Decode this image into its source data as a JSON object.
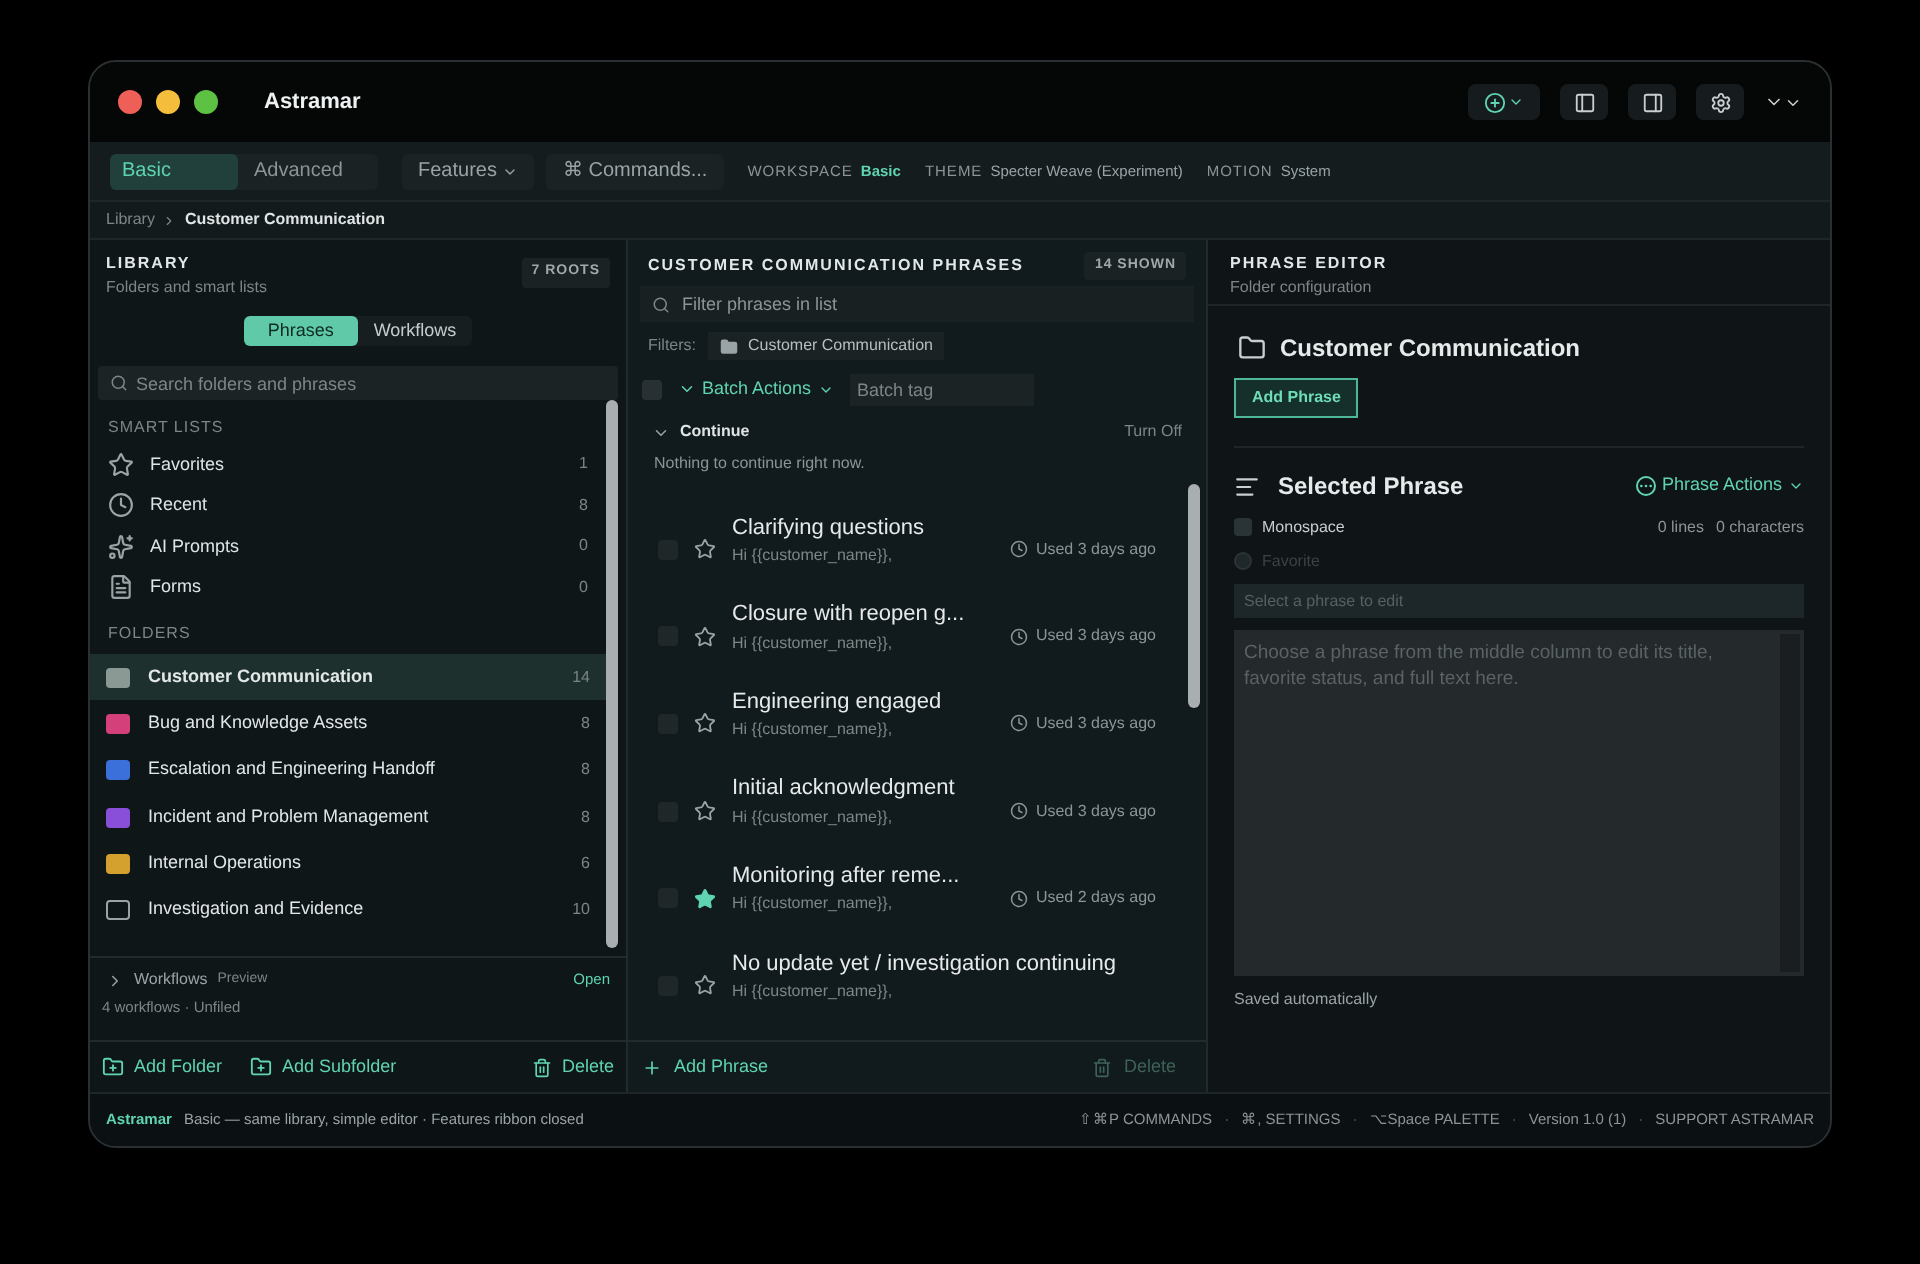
{
  "window": {
    "title": "Astramar"
  },
  "toolbar": {
    "modes": [
      {
        "label": "Basic",
        "selected": true
      },
      {
        "label": "Advanced",
        "selected": false
      }
    ],
    "features": "Features",
    "commands": "⌘ Commands...",
    "settings": [
      {
        "label": "WORKSPACE",
        "value": "Basic",
        "accent": true
      },
      {
        "label": "THEME",
        "value": "Specter Weave (Experiment)",
        "accent": false
      },
      {
        "label": "MOTION",
        "value": "System",
        "accent": false
      }
    ]
  },
  "breadcrumb": [
    "Library",
    "Customer Communication"
  ],
  "library": {
    "title": "LIBRARY",
    "subtitle": "Folders and smart lists",
    "badge": "7 ROOTS",
    "segments": [
      {
        "label": "Phrases",
        "selected": true
      },
      {
        "label": "Workflows",
        "selected": false
      }
    ],
    "search": {
      "placeholder": "Search folders and phrases"
    },
    "smart_lists_title": "SMART LISTS",
    "smart_lists": [
      {
        "kind": "star",
        "label": "Favorites",
        "count": "1"
      },
      {
        "kind": "clock",
        "label": "Recent",
        "count": "8"
      },
      {
        "kind": "sparkle",
        "label": "AI Prompts",
        "count": "0"
      },
      {
        "kind": "form",
        "label": "Forms",
        "count": "0"
      }
    ],
    "folders_title": "FOLDERS",
    "folders": [
      {
        "label": "Customer Communication",
        "count": "14",
        "color": "#8b9994",
        "kind": "filled",
        "selected": true
      },
      {
        "label": "Bug and Knowledge Assets",
        "count": "8",
        "color": "#d4407a",
        "kind": "filled",
        "selected": false
      },
      {
        "label": "Escalation and Engineering Handoff",
        "count": "8",
        "color": "#3b6fd9",
        "kind": "filled",
        "selected": false
      },
      {
        "label": "Incident and Problem Management",
        "count": "8",
        "color": "#8a4fd8",
        "kind": "filled",
        "selected": false
      },
      {
        "label": "Internal Operations",
        "count": "6",
        "color": "#d4a12e",
        "kind": "filled",
        "selected": false
      },
      {
        "label": "Investigation and Evidence",
        "count": "10",
        "color": "#9aa3a6",
        "kind": "outline",
        "selected": false
      }
    ],
    "workflows": {
      "label": "Workflows",
      "tag": "Preview",
      "action": "Open",
      "summary": "4 workflows · Unfiled",
      "expanded": false
    },
    "footer": [
      {
        "kind": "folder",
        "label": "Add Folder"
      },
      {
        "kind": "folder",
        "label": "Add Subfolder"
      },
      {
        "kind": "delete",
        "label": "Delete"
      }
    ]
  },
  "phrases": {
    "title": "CUSTOMER COMMUNICATION PHRASES",
    "badge": "14 SHOWN",
    "filter": {
      "placeholder": "Filter phrases in list"
    },
    "filters_label": "Filters:",
    "filter_chip": "Customer Communication",
    "batch": {
      "checked": false,
      "label": "Batch Actions",
      "tag_placeholder": "Batch tag"
    },
    "continue": {
      "label": "Continue",
      "action": "Turn Off",
      "empty": "Nothing to continue right now.",
      "expanded": true
    },
    "items": [
      {
        "title": "Clarifying questions",
        "preview": "Hi {{customer_name}},",
        "used": "Used 3 days ago",
        "favorite": false,
        "checked": false
      },
      {
        "title": "Closure with reopen g...",
        "preview": "Hi {{customer_name}},",
        "used": "Used 3 days ago",
        "favorite": false,
        "checked": false
      },
      {
        "title": "Engineering engaged",
        "preview": "Hi {{customer_name}},",
        "used": "Used 3 days ago",
        "favorite": false,
        "checked": false
      },
      {
        "title": "Initial acknowledgment",
        "preview": "Hi {{customer_name}},",
        "used": "Used 3 days ago",
        "favorite": false,
        "checked": false
      },
      {
        "title": "Monitoring after reme...",
        "preview": "Hi {{customer_name}},",
        "used": "Used 2 days ago",
        "favorite": true,
        "checked": false
      },
      {
        "title": "No update yet / investigation continuing",
        "preview": "Hi {{customer_name}},",
        "favorite": false,
        "checked": false
      }
    ],
    "footer": [
      {
        "kind": "add",
        "label": "Add Phrase",
        "disabled": false
      },
      {
        "kind": "delete",
        "label": "Delete",
        "disabled": true
      }
    ]
  },
  "editor": {
    "title": "PHRASE EDITOR",
    "subtitle": "Folder configuration",
    "folder": "Customer Communication",
    "add_button": "Add Phrase",
    "selected_title": "Selected Phrase",
    "actions": "Phrase Actions",
    "options": [
      {
        "label": "Monospace",
        "checked": false,
        "disabled": false
      },
      {
        "label": "Favorite",
        "checked": false,
        "disabled": true
      }
    ],
    "stats": [
      "0 lines",
      "0 characters"
    ],
    "title_field": {
      "placeholder": "Select a phrase to edit"
    },
    "body_field": {
      "placeholder": "Choose a phrase from the middle column to edit its title, favorite status, and full text here."
    },
    "status": "Saved automatically"
  },
  "status_bar": {
    "app": "Astramar",
    "message": "Basic — same library, simple editor · Features ribbon closed",
    "shortcuts": [
      "⇧⌘P COMMANDS",
      "⌘, SETTINGS",
      "⌥Space PALETTE",
      "Version 1.0 (1)",
      "SUPPORT ASTRAMAR"
    ],
    "separator": "·"
  }
}
